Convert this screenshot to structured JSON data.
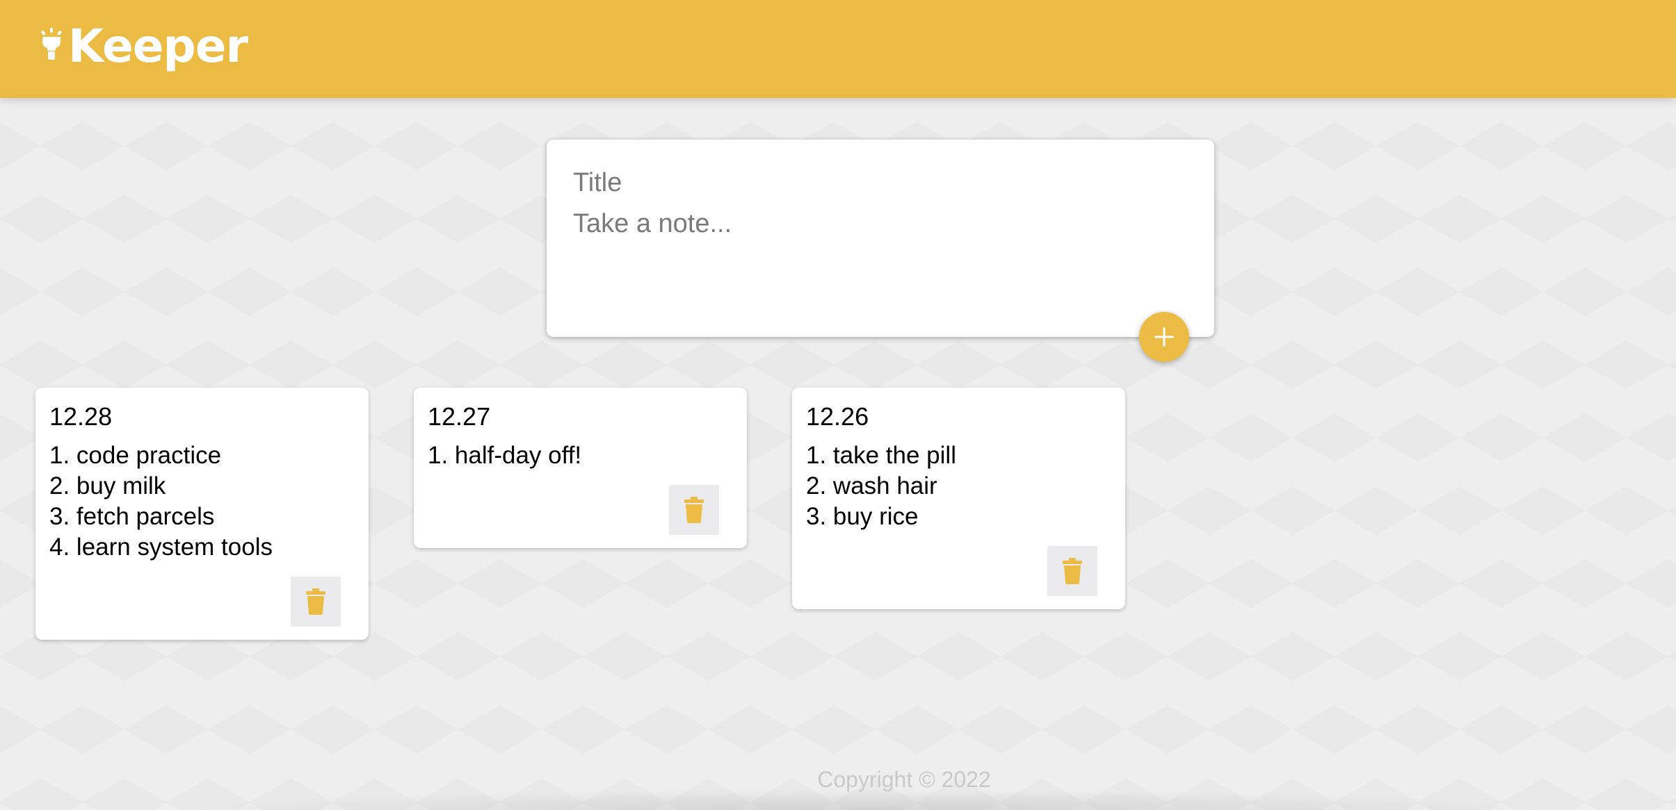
{
  "app": {
    "brand_name": "Keeper",
    "brand_color": "#ecbb44",
    "logo_icon": "lightbulb-icon"
  },
  "create_area": {
    "title_placeholder": "Title",
    "content_placeholder": "Take a note...",
    "title_value": "",
    "content_value": "",
    "add_icon": "plus-icon"
  },
  "notes": [
    {
      "title": "12.28",
      "lines": [
        "1. code practice",
        "2. buy milk",
        "3. fetch parcels",
        "4. learn system tools"
      ],
      "delete_icon": "trash-icon"
    },
    {
      "title": "12.27",
      "lines": [
        "1. half-day off!"
      ],
      "delete_icon": "trash-icon"
    },
    {
      "title": "12.26",
      "lines": [
        "1. take the pill",
        "2. wash hair",
        "3. buy rice"
      ],
      "delete_icon": "trash-icon"
    }
  ],
  "footer": {
    "copyright": "Copyright © 2022"
  }
}
